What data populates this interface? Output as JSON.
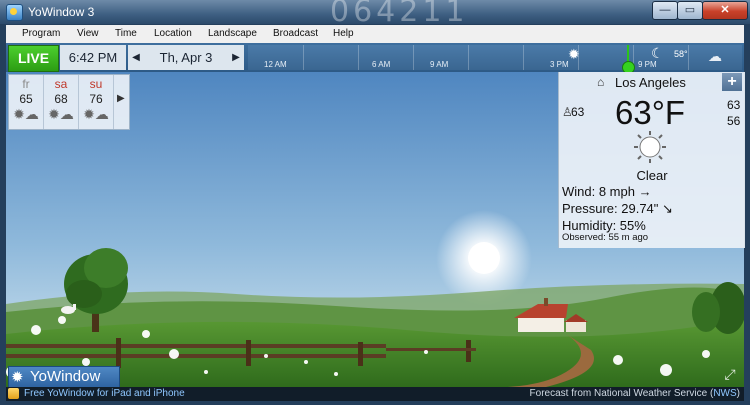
{
  "window": {
    "title": "YoWindow 3",
    "deco_digits": "064211",
    "buttons": {
      "minimize": "—",
      "maximize": "▭",
      "close": "✕"
    }
  },
  "menu": [
    "Program",
    "View",
    "Time",
    "Location",
    "Landscape",
    "Broadcast",
    "Help"
  ],
  "timebar": {
    "live_label": "LIVE",
    "time": "6:42 PM",
    "date": "Th, Apr 3",
    "prev_glyph": "◀",
    "next_glyph": "▶",
    "timeline_labels": [
      "12 AM",
      "6 AM",
      "9 AM",
      "3 PM",
      "9 PM"
    ],
    "timeline_temp": "58°"
  },
  "forecast": {
    "days": [
      {
        "name": "fr",
        "temp": "65",
        "weekend": false,
        "icon": "sun-cloud-icon"
      },
      {
        "name": "sa",
        "temp": "68",
        "weekend": true,
        "icon": "sun-cloud-icon"
      },
      {
        "name": "su",
        "temp": "76",
        "weekend": true,
        "icon": "sun-cloud-icon"
      }
    ],
    "next_glyph": "▶"
  },
  "current": {
    "location": "Los Angeles",
    "plus_label": "+",
    "feels_like": "63",
    "temperature": "63°F",
    "high": "63",
    "low": "56",
    "condition": "Clear",
    "wind": "Wind:  8 mph →",
    "pressure": "Pressure:  29.74\" ↘",
    "humidity": "Humidity:  55%",
    "observed": "Observed:  55 m ago"
  },
  "bottom": {
    "brand": "YoWindow",
    "promo": "Free YoWindow for iPad and iPhone",
    "credit_prefix": "Forecast from National Weather Service (",
    "credit_link": "NWS",
    "credit_suffix": ")"
  },
  "colors": {
    "live": "#2c9d13",
    "sky_top": "#5d8fc4",
    "sky_bottom": "#cfe3f0",
    "grass": "#4a8a2c",
    "titlebar": "#3e5f82"
  }
}
